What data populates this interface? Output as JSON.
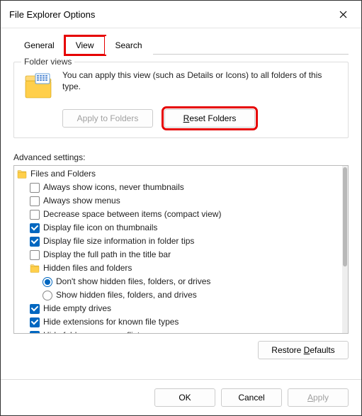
{
  "window": {
    "title": "File Explorer Options"
  },
  "tabs": {
    "general": "General",
    "view": "View",
    "search": "Search",
    "active": "view"
  },
  "folder_views": {
    "group_label": "Folder views",
    "description": "You can apply this view (such as Details or Icons) to all folders of this type.",
    "apply_label": "Apply to Folders",
    "reset_label_pre": "",
    "reset_label_u": "R",
    "reset_label_post": "eset Folders"
  },
  "advanced": {
    "label": "Advanced settings:",
    "root_label": "Files and Folders",
    "items": [
      {
        "type": "checkbox",
        "checked": false,
        "label": "Always show icons, never thumbnails"
      },
      {
        "type": "checkbox",
        "checked": false,
        "label": "Always show menus"
      },
      {
        "type": "checkbox",
        "checked": false,
        "label": "Decrease space between items (compact view)"
      },
      {
        "type": "checkbox",
        "checked": true,
        "label": "Display file icon on thumbnails"
      },
      {
        "type": "checkbox",
        "checked": true,
        "label": "Display file size information in folder tips"
      },
      {
        "type": "checkbox",
        "checked": false,
        "label": "Display the full path in the title bar"
      },
      {
        "type": "folder",
        "label": "Hidden files and folders"
      },
      {
        "type": "radio",
        "selected": true,
        "indent": 2,
        "label": "Don't show hidden files, folders, or drives"
      },
      {
        "type": "radio",
        "selected": false,
        "indent": 2,
        "label": "Show hidden files, folders, and drives"
      },
      {
        "type": "checkbox",
        "checked": true,
        "label": "Hide empty drives"
      },
      {
        "type": "checkbox",
        "checked": true,
        "label": "Hide extensions for known file types"
      },
      {
        "type": "checkbox",
        "checked": true,
        "label": "Hide folder merge conflicts"
      }
    ],
    "restore_pre": "Restore ",
    "restore_u": "D",
    "restore_post": "efaults"
  },
  "footer": {
    "ok": "OK",
    "cancel": "Cancel",
    "apply_pre": "",
    "apply_u": "A",
    "apply_post": "pply"
  }
}
